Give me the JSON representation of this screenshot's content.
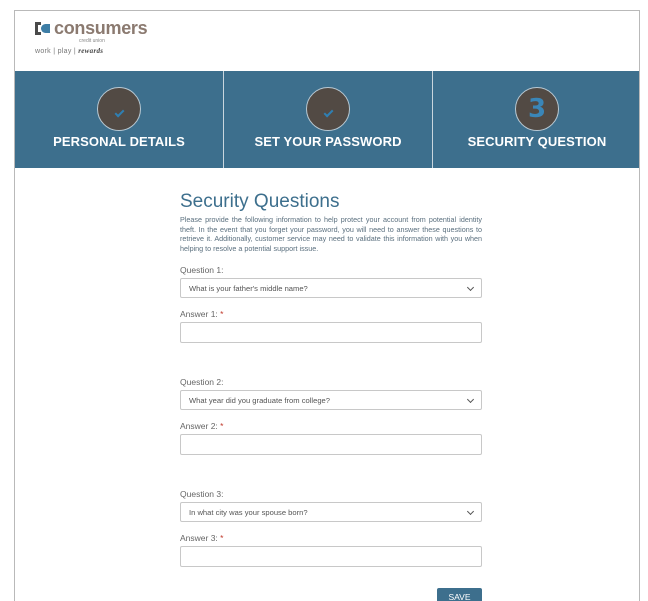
{
  "brand": {
    "name": "consumers",
    "sub": "credit union",
    "tagline": "work | play | ",
    "tagline_em": "rewards"
  },
  "steps": [
    {
      "label": "PERSONAL DETAILS",
      "state": "complete",
      "icon": "check-icon"
    },
    {
      "label": "SET YOUR PASSWORD",
      "state": "complete",
      "icon": "check-icon"
    },
    {
      "label": "SECURITY QUESTION",
      "state": "current",
      "number": "3"
    }
  ],
  "colors": {
    "accent": "#3d6f8d",
    "step_circle": "#524a44",
    "required": "#c0392b"
  },
  "form": {
    "title": "Security Questions",
    "intro": "Please provide the following information to help protect your account from potential identity theft. In the event that you forget your password, you will need to answer these questions to retrieve it. Additionally, customer service may need to validate this information with you when helping to resolve a potential support issue.",
    "questions": [
      {
        "label": "Question 1:",
        "selected": "What is your father's middle name?",
        "answer_label": "Answer 1:",
        "required_mark": "*",
        "answer_value": ""
      },
      {
        "label": "Question 2:",
        "selected": "What year did you graduate from college?",
        "answer_label": "Answer 2:",
        "required_mark": "*",
        "answer_value": ""
      },
      {
        "label": "Question 3:",
        "selected": "In what city was your spouse born?",
        "answer_label": "Answer 3:",
        "required_mark": "*",
        "answer_value": ""
      }
    ],
    "save_label": "SAVE"
  }
}
